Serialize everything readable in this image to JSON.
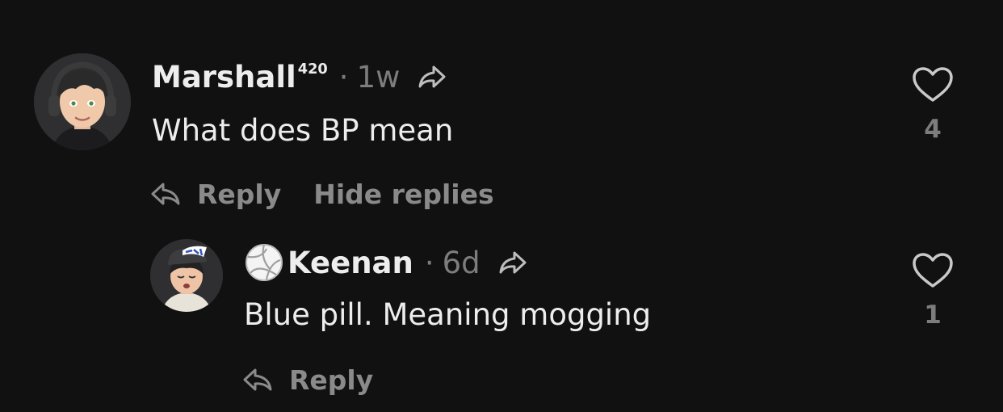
{
  "comments": [
    {
      "author": "Marshall",
      "author_suffix": "420",
      "separator": "·",
      "time": "1w",
      "text": "What does BP mean",
      "likes": "4",
      "reply_label": "Reply",
      "hide_replies_label": "Hide replies",
      "icons": {
        "share": "share-arrow-icon",
        "like": "heart-icon",
        "reply": "reply-arrow-icon",
        "avatar": "avatar-headphones-boy"
      }
    }
  ],
  "replies": [
    {
      "author_prefix_icon": "volleyball-icon",
      "author": "Keenan",
      "separator": "·",
      "time": "6d",
      "text": "Blue pill. Meaning mogging",
      "likes": "1",
      "reply_label": "Reply",
      "icons": {
        "share": "share-arrow-icon",
        "like": "heart-icon",
        "reply": "reply-arrow-icon",
        "avatar": "avatar-cap-boy"
      }
    }
  ],
  "colors": {
    "background": "#111111",
    "primary_text": "#ededed",
    "secondary_text": "#7d7d7d",
    "action_text": "#8a8a8a"
  }
}
